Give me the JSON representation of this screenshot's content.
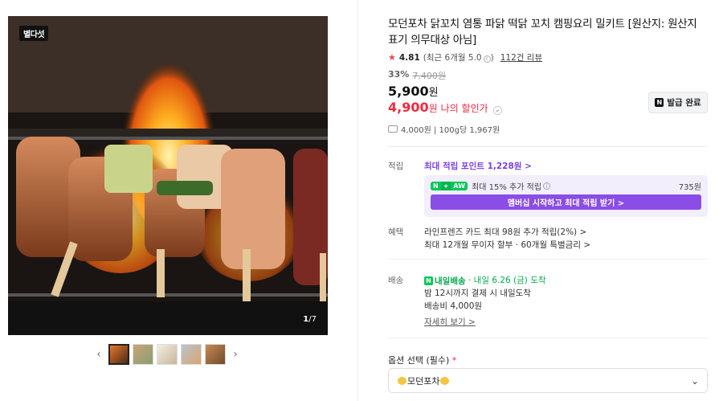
{
  "gallery": {
    "brand_badge": "별다섯",
    "counter_current": "1",
    "counter_total": "/7",
    "prev_icon": "chevron-left",
    "next_icon": "chevron-right",
    "thumb_count": 5
  },
  "product": {
    "title": "모던포차 닭꼬치 염통 파닭 떡닭 꼬치 캠핑요리 밀키트 [원산지: 원산지 표기 의무대상 아님]",
    "rating": "4.81",
    "rating_detail": "(최근 6개월 5.0",
    "rating_detail_end": ")",
    "review_count": "112건 리뷰",
    "discount_pct": "33%",
    "original_price": "7,400원",
    "price": "5,900",
    "price_unit": "원",
    "my_price": "4,900",
    "my_price_unit": "원",
    "my_price_label": "나의 할인가",
    "coupon_button": "발급 완료",
    "coupon_mark": "N",
    "unit_info": "4,000원 | 100g당 1,967원"
  },
  "points": {
    "label": "적립",
    "main": "최대 적립 포인트 1,228원 >",
    "membership_text": "최대 15% 추가 적립",
    "membership_amount": "735원",
    "membership_button": "멤버십 시작하고 최대 적립 받기 >",
    "badge_n": "N",
    "badge_plus": "+",
    "badge_aw": "AW"
  },
  "benefits": {
    "label": "혜택",
    "line1": "라인프렌즈 카드 최대 98원 추가 적립(2%) >",
    "line2": "최대 12개월 무이자 할부 · 60개월 특별금리 >"
  },
  "shipping": {
    "label": "배송",
    "badge": "내일배송",
    "badge_mark": "N",
    "date": "· 내일 6.26 (금) 도착",
    "line2": "밤 12시까지 결제 시 내일도착",
    "fee": "배송비 4,000원",
    "detail_link": "자세히 보기 >"
  },
  "options": {
    "label": "옵션 선택 (필수)",
    "required_mark": "*",
    "selected": "모던포차",
    "caret_icon": "chevron-down"
  },
  "colors": {
    "accent_red": "#f0293e",
    "point_purple": "#7b3fe4",
    "naver_green": "#03c75a"
  }
}
